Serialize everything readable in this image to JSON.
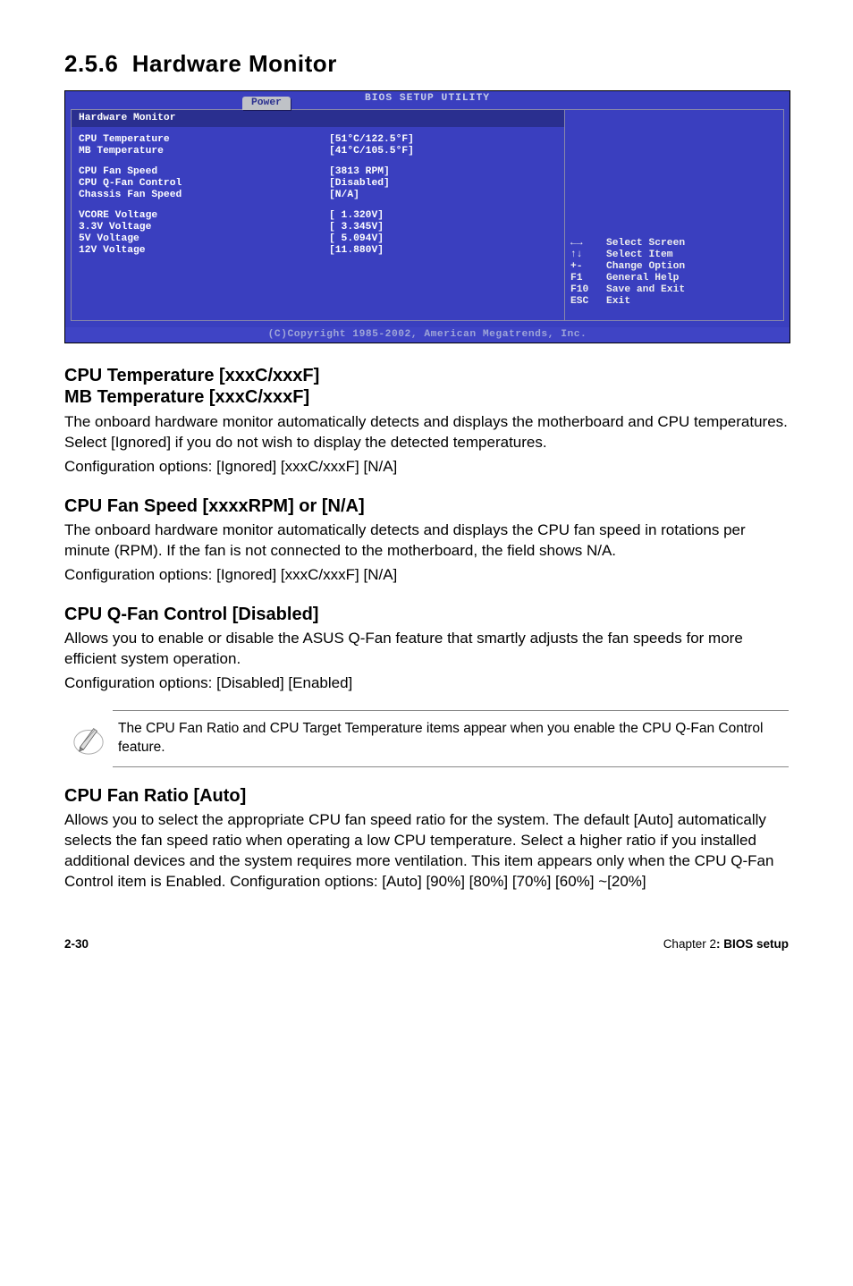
{
  "section": {
    "number": "2.5.6",
    "title": "Hardware Monitor"
  },
  "bios": {
    "titlebar": "BIOS SETUP UTILITY",
    "tab": "Power",
    "subheader": "Hardware Monitor",
    "rows": [
      {
        "label": "CPU Temperature",
        "value": "[51°C/122.5°F]"
      },
      {
        "label": "MB Temperature",
        "value": "[41°C/105.5°F]"
      }
    ],
    "rows2": [
      {
        "label": "CPU Fan Speed",
        "value": "[3813 RPM]"
      },
      {
        "label": "CPU Q-Fan Control",
        "value": "[Disabled]"
      },
      {
        "label": "Chassis Fan Speed",
        "value": "[N/A]"
      }
    ],
    "rows3": [
      {
        "label": "VCORE Voltage",
        "value": "[ 1.320V]"
      },
      {
        "label": "3.3V Voltage",
        "value": "[ 3.345V]"
      },
      {
        "label": "5V Voltage",
        "value": "[ 5.094V]"
      },
      {
        "label": "12V Voltage",
        "value": "[11.880V]"
      }
    ],
    "help": [
      {
        "key": "←→",
        "desc": "Select Screen"
      },
      {
        "key": "↑↓",
        "desc": "Select Item"
      },
      {
        "key": "+-",
        "desc": "Change Option"
      },
      {
        "key": "F1",
        "desc": "General Help"
      },
      {
        "key": "F10",
        "desc": "Save and Exit"
      },
      {
        "key": "ESC",
        "desc": "Exit"
      }
    ],
    "footer": "(C)Copyright 1985-2002, American Megatrends, Inc."
  },
  "blocks": {
    "cpu_mb_temp": {
      "h_line1": "CPU Temperature [xxxC/xxxF]",
      "h_line2": "MB Temperature [xxxC/xxxF]",
      "p1": "The onboard hardware monitor automatically detects and displays the motherboard and CPU temperatures. Select [Ignored] if you do not wish to display the detected temperatures.",
      "p2": "Configuration options: [Ignored] [xxxC/xxxF] [N/A]"
    },
    "cpu_fan_speed": {
      "h": "CPU Fan Speed [xxxxRPM] or [N/A]",
      "p1": "The onboard hardware monitor automatically detects and displays the CPU fan speed in rotations per minute (RPM). If the fan is not connected to the motherboard, the field shows N/A.",
      "p2": "Configuration options: [Ignored] [xxxC/xxxF] [N/A]"
    },
    "cpu_qfan": {
      "h": "CPU Q-Fan Control [Disabled]",
      "p1": "Allows you to enable or disable the ASUS Q-Fan feature that smartly adjusts the fan speeds for more efficient system operation.",
      "p2": "Configuration options: [Disabled] [Enabled]"
    },
    "callout": {
      "text": "The CPU Fan Ratio and CPU Target Temperature items appear when you enable the CPU Q-Fan Control feature."
    },
    "cpu_fan_ratio": {
      "h": "CPU Fan Ratio [Auto]",
      "p1": "Allows you to select the appropriate CPU fan speed ratio for the system. The default [Auto] automatically selects the fan speed ratio when operating a low CPU temperature. Select a higher ratio if you installed additional devices and the system requires more ventilation. This item appears only when the CPU Q-Fan Control item is Enabled. Configuration options: [Auto] [90%] [80%] [70%] [60%] ~[20%]"
    }
  },
  "footer": {
    "left": "2-30",
    "right_prefix": "Chapter 2",
    "right_bold": ": BIOS setup"
  }
}
